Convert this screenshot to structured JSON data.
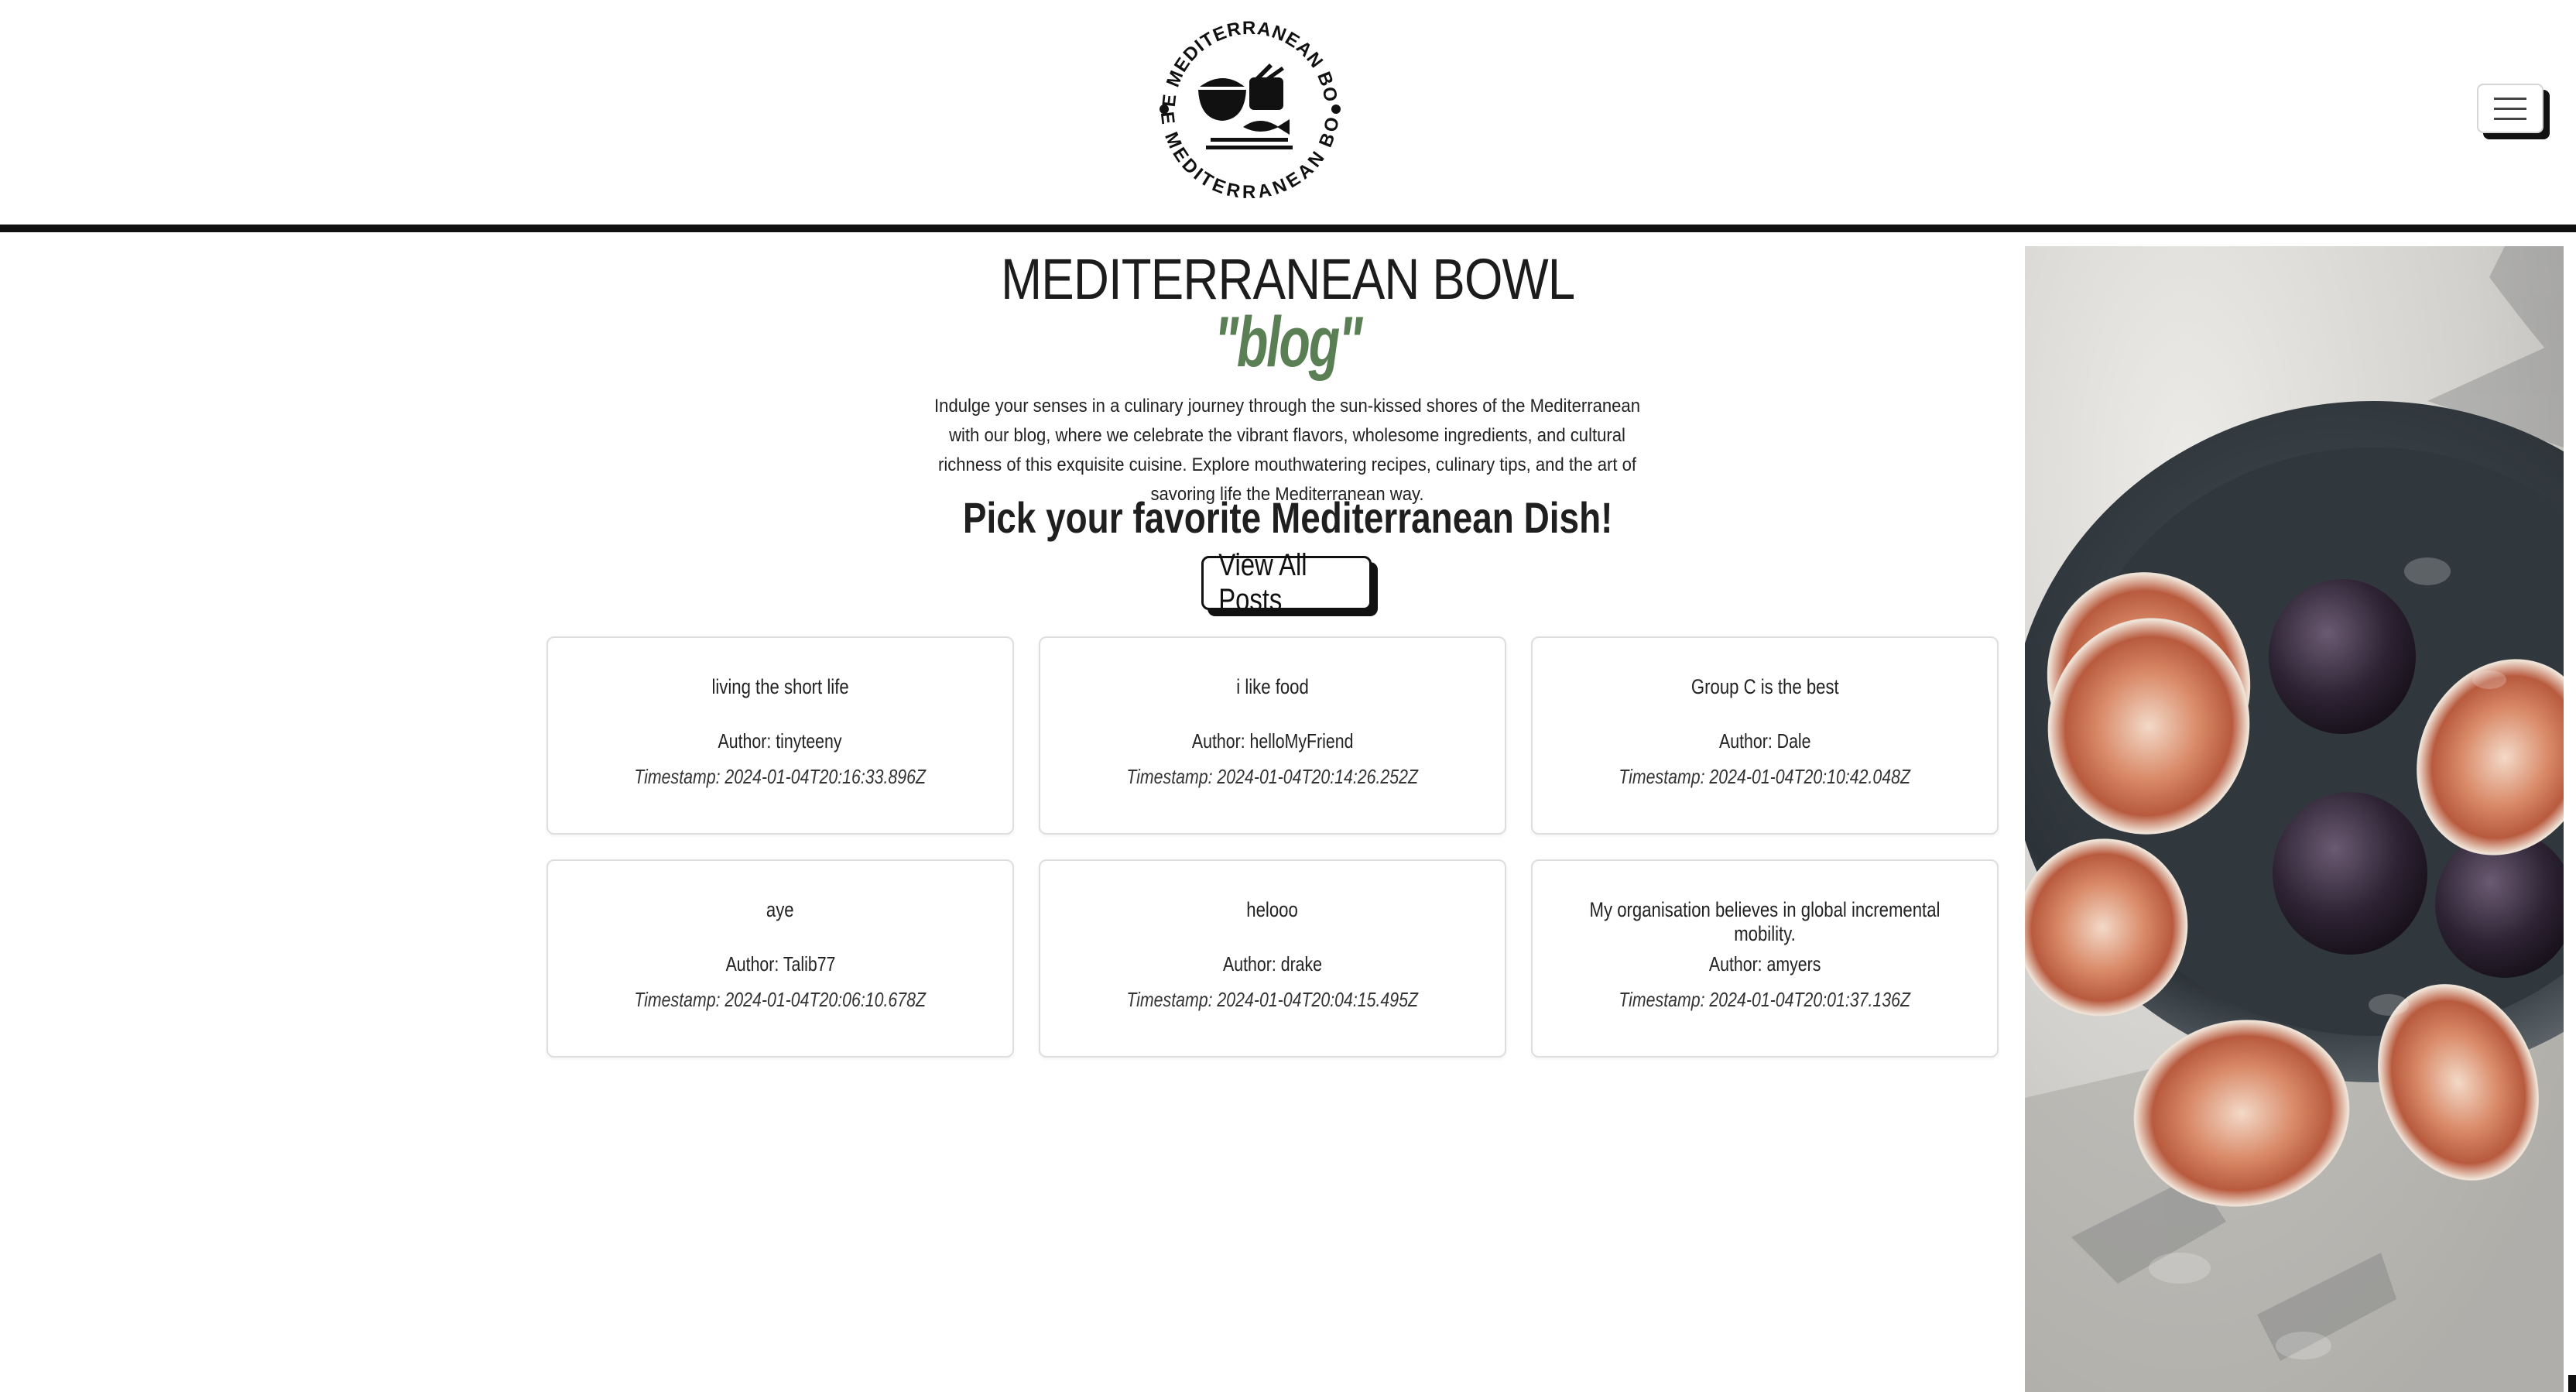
{
  "header": {
    "logo": {
      "text_top": "THE MEDITERRANEAN BOWL",
      "text_bottom": "THE MEDITERRANEAN BOWL",
      "icon": "bowl-and-fish-logo"
    },
    "menu_icon": "hamburger-icon"
  },
  "main": {
    "title": "MEDITERRANEAN BOWL",
    "subtitle": "\"blog\"",
    "intro": "Indulge your senses in a culinary journey through the sun-kissed shores of the Mediterranean with our blog, where we celebrate the vibrant flavors, wholesome ingredients, and cultural richness of this exquisite cuisine. Explore mouthwatering recipes, culinary tips, and the art of savoring life the Mediterranean way.",
    "heading": "Pick your favorite Mediterranean Dish!",
    "view_all_label": "View All Posts",
    "posts": [
      {
        "title": "living the short life",
        "author": "Author: tinyteeny",
        "timestamp": "Timestamp: 2024-01-04T20:16:33.896Z"
      },
      {
        "title": "i like food",
        "author": "Author: helloMyFriend",
        "timestamp": "Timestamp: 2024-01-04T20:14:26.252Z"
      },
      {
        "title": "Group C is the best",
        "author": "Author: Dale",
        "timestamp": "Timestamp: 2024-01-04T20:10:42.048Z"
      },
      {
        "title": "aye",
        "author": "Author: Talib77",
        "timestamp": "Timestamp: 2024-01-04T20:06:10.678Z"
      },
      {
        "title": "helooo",
        "author": "Author: drake",
        "timestamp": "Timestamp: 2024-01-04T20:04:15.495Z"
      },
      {
        "title": "My organisation believes in global incremental mobility.",
        "author": "Author: amyers",
        "timestamp": "Timestamp: 2024-01-04T20:01:37.136Z"
      }
    ]
  },
  "sidebar_image": {
    "icon": "figs-on-plate-photo"
  },
  "colors": {
    "accent": "#5b7f55",
    "rule": "#111111",
    "text": "#1f1f1f"
  }
}
